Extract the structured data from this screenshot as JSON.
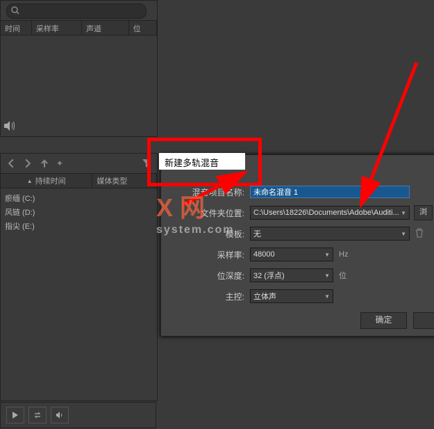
{
  "top_panel": {
    "headers": {
      "time": "时间",
      "sample_rate": "采样率",
      "channel": "声道",
      "bit": "位"
    }
  },
  "mid_panel": {
    "headers": {
      "duration": "持续时间",
      "media_type": "媒体类型"
    },
    "files": [
      "瘀缅 (C:)",
      "风链 (D:)",
      "指尖 (E:)"
    ]
  },
  "dialog": {
    "title": "新建多轨混音",
    "labels": {
      "name": "混音项目名称:",
      "folder": "文件夹位置:",
      "template": "模板:",
      "sample_rate": "采样率:",
      "bit_depth": "位深度:",
      "master": "主控:"
    },
    "values": {
      "name": "未命名混音 1",
      "folder": "C:\\Users\\18226\\Documents\\Adobe\\Auditi...",
      "template": "无",
      "sample_rate": "48000",
      "bit_depth": "32 (浮点)",
      "master": "立体声"
    },
    "units": {
      "hz": "Hz",
      "bit": "位"
    },
    "browse": "浏",
    "ok": "确定"
  },
  "watermark": {
    "main": "X  网",
    "sub": "system.com"
  }
}
